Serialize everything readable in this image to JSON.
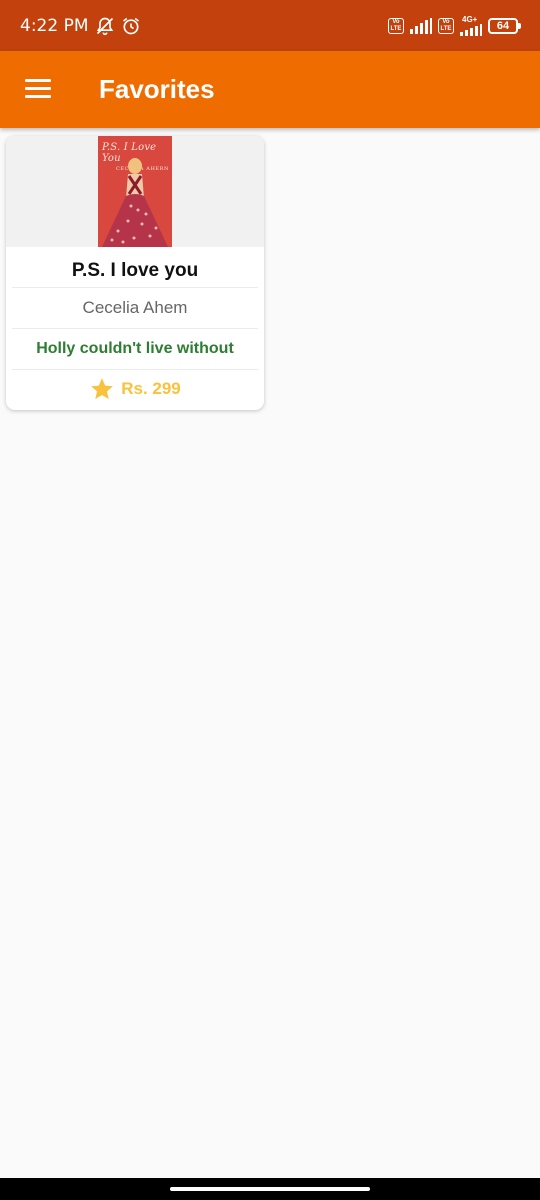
{
  "status_bar": {
    "time": "4:22 PM",
    "sim1_badge_top": "Vo",
    "sim1_badge_bottom": "LTE",
    "sim2_badge_top": "Vo",
    "sim2_badge_bottom": "LTE",
    "network_type": "4G+",
    "battery_level": "64",
    "icons": [
      "muted-bell-icon",
      "alarm-icon",
      "signal-icon",
      "battery-icon"
    ]
  },
  "app_bar": {
    "title": "Favorites",
    "menu_icon": "hamburger-menu-icon",
    "color": "#ef6c00"
  },
  "favorites": [
    {
      "cover_title": "P.S. I Love You",
      "cover_author": "CECELIA AHERN",
      "title": "P.S. I love you",
      "author": "Cecelia Ahem",
      "description": "Holly couldn't live without",
      "price": "Rs. 299",
      "rating_icon": "star-icon"
    }
  ],
  "colors": {
    "status_bar": "#c2410c",
    "accent": "#ef6c00",
    "description_text": "#2e7d32",
    "price_text": "#f9c23c"
  }
}
